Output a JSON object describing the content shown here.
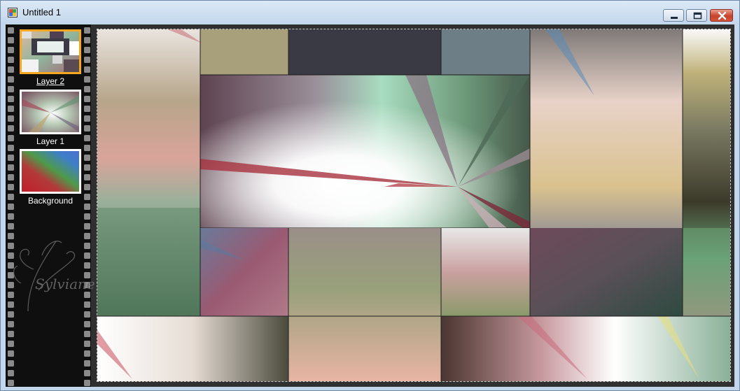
{
  "window": {
    "title": "Untitled 1"
  },
  "titlebar_buttons": {
    "minimize": "minimize-icon",
    "maximize": "maximize-icon",
    "close": "close-icon"
  },
  "layers": [
    {
      "label": "Layer 2",
      "selected": true
    },
    {
      "label": "Layer 1",
      "selected": false
    },
    {
      "label": "Background",
      "selected": false
    }
  ],
  "watermark": {
    "text": "Sylviane"
  },
  "colors": {
    "title_bar": "#c2d6ec",
    "close_button": "#c8432c",
    "selected_layer_border": "#f5a623",
    "filmstrip": "#0f0f0f",
    "workspace": "#303030"
  }
}
